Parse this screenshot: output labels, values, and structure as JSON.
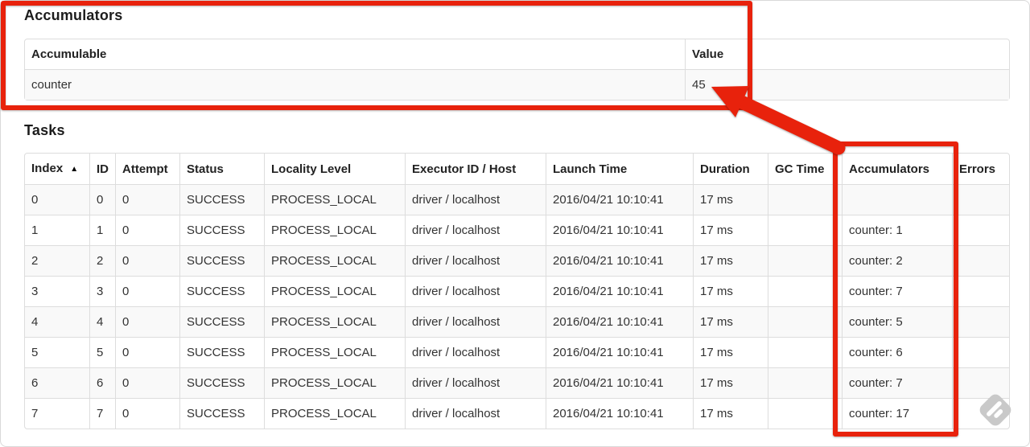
{
  "page": {
    "accumulators_title": "Accumulators",
    "tasks_title": "Tasks"
  },
  "accumulators": {
    "headers": [
      "Accumulable",
      "Value"
    ],
    "rows": [
      [
        "counter",
        "45"
      ]
    ]
  },
  "tasks": {
    "headers": [
      "Index",
      "ID",
      "Attempt",
      "Status",
      "Locality Level",
      "Executor ID / Host",
      "Launch Time",
      "Duration",
      "GC Time",
      "Accumulators",
      "Errors"
    ],
    "sort_icon": "▲",
    "rows": [
      [
        "0",
        "0",
        "0",
        "SUCCESS",
        "PROCESS_LOCAL",
        "driver / localhost",
        "2016/04/21 10:10:41",
        "17 ms",
        "",
        "",
        ""
      ],
      [
        "1",
        "1",
        "0",
        "SUCCESS",
        "PROCESS_LOCAL",
        "driver / localhost",
        "2016/04/21 10:10:41",
        "17 ms",
        "",
        "counter: 1",
        ""
      ],
      [
        "2",
        "2",
        "0",
        "SUCCESS",
        "PROCESS_LOCAL",
        "driver / localhost",
        "2016/04/21 10:10:41",
        "17 ms",
        "",
        "counter: 2",
        ""
      ],
      [
        "3",
        "3",
        "0",
        "SUCCESS",
        "PROCESS_LOCAL",
        "driver / localhost",
        "2016/04/21 10:10:41",
        "17 ms",
        "",
        "counter: 7",
        ""
      ],
      [
        "4",
        "4",
        "0",
        "SUCCESS",
        "PROCESS_LOCAL",
        "driver / localhost",
        "2016/04/21 10:10:41",
        "17 ms",
        "",
        "counter: 5",
        ""
      ],
      [
        "5",
        "5",
        "0",
        "SUCCESS",
        "PROCESS_LOCAL",
        "driver / localhost",
        "2016/04/21 10:10:41",
        "17 ms",
        "",
        "counter: 6",
        ""
      ],
      [
        "6",
        "6",
        "0",
        "SUCCESS",
        "PROCESS_LOCAL",
        "driver / localhost",
        "2016/04/21 10:10:41",
        "17 ms",
        "",
        "counter: 7",
        ""
      ],
      [
        "7",
        "7",
        "0",
        "SUCCESS",
        "PROCESS_LOCAL",
        "driver / localhost",
        "2016/04/21 10:10:41",
        "17 ms",
        "",
        "counter: 17",
        ""
      ]
    ]
  },
  "annotation": {
    "red": "#e8220c",
    "highlighted_value": "45",
    "highlighted_column": "Accumulators"
  },
  "colors": {
    "table_border": "#dddddd",
    "stripe": "#f9f9f9",
    "watermark_gray": "#c9c9c9"
  }
}
